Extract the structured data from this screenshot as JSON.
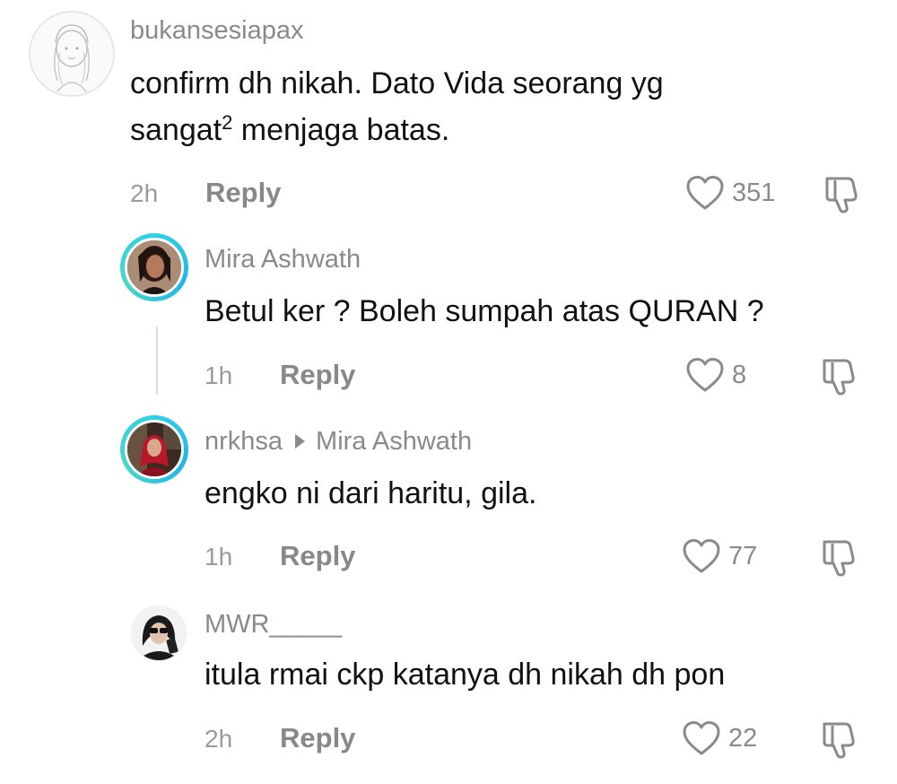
{
  "comments": [
    {
      "username": "bukansesiapax",
      "text_line1": "confirm dh nikah. Dato Vida seorang yg",
      "text_line2_pre": "sangat",
      "text_line2_sup": "2",
      "text_line2_post": " menjaga batas.",
      "time": "2h",
      "reply_label": "Reply",
      "likes": "351"
    },
    {
      "username": "Mira Ashwath",
      "text": "Betul ker ? Boleh sumpah atas QURAN ?",
      "time": "1h",
      "reply_label": "Reply",
      "likes": "8"
    },
    {
      "username": "nrkhsa",
      "reply_to": "Mira Ashwath",
      "text": "engko ni dari haritu, gila.",
      "time": "1h",
      "reply_label": "Reply",
      "likes": "77"
    },
    {
      "username": "MWR_____",
      "text": "itula rmai ckp katanya dh nikah dh pon",
      "time": "2h",
      "reply_label": "Reply",
      "likes": "22"
    }
  ],
  "colors": {
    "story_ring": "#2fd0e6",
    "secondary_text": "#8a8a8a",
    "primary_text": "#111111"
  },
  "icons": {
    "like": "heart-outline-icon",
    "dislike": "thumbs-down-outline-icon"
  }
}
